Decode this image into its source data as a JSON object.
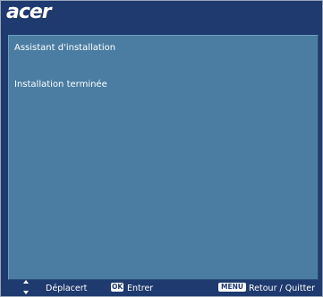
{
  "header": {
    "brand": "acer"
  },
  "panel": {
    "title": "Assistant d'installation",
    "status": "Installation terminée"
  },
  "footer": {
    "move_label": "Déplacert",
    "ok_key": "OK",
    "enter_label": "Entrer",
    "menu_key": "MENU",
    "back_label": "Retour / Quitter",
    "arrow_icon": "up-down-arrows-icon"
  },
  "colors": {
    "background": "#1e3a6e",
    "panel": "#4b7da3",
    "text": "#ffffff"
  }
}
